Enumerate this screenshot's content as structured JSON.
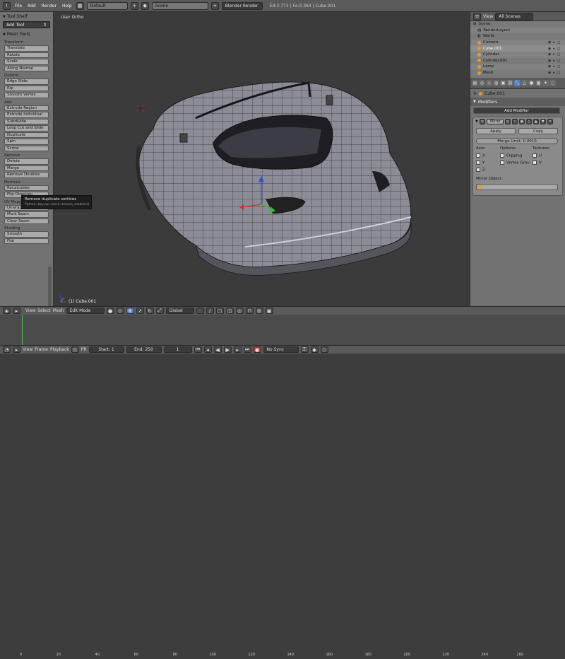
{
  "topbar": {
    "menus": [
      "File",
      "Add",
      "Render",
      "Help"
    ],
    "layout": "Default",
    "scene": "Scene",
    "engine": "Blender Render",
    "stats": "Ed:3-771 | Fa:0-364 | Cube.001"
  },
  "toolshelf": {
    "title": "Tool Shelf",
    "add_tool": "Add Tool",
    "panel": "Mesh Tools",
    "groups": [
      {
        "label": "Transform",
        "buttons": [
          "Translate",
          "Rotate",
          "Scale",
          "Along Normal"
        ]
      },
      {
        "label": "Deform",
        "buttons": [
          "Edge Slide",
          "Rip",
          "Smooth Vertex"
        ]
      },
      {
        "label": "Add",
        "buttons": [
          "Extrude Region",
          "Extrude Individual",
          "Subdivide",
          "Loop Cut and Slide",
          "Duplicate",
          "Spin",
          "Screw"
        ]
      },
      {
        "label": "Remove",
        "buttons": [
          "Delete",
          "Merge",
          "Remove Doubles"
        ]
      },
      {
        "label": "Normals",
        "buttons": [
          "Recalculate",
          "Flip Direction"
        ]
      },
      {
        "label": "UV Mapping",
        "buttons": [
          "Unwrap",
          "Mark Seam",
          "Clear Seam"
        ]
      },
      {
        "label": "Shading",
        "buttons": [
          "Smooth",
          "Flat"
        ]
      }
    ]
  },
  "viewport": {
    "label": "User Ortho",
    "object_label": "(1) Cube.001",
    "tooltip_title": "Remove duplicate vertices",
    "tooltip_python": "Python: bpy.ops.mesh.remove_doubles()"
  },
  "outliner": {
    "view": "View",
    "search": "All Scenes",
    "rows": [
      "Scene",
      "RenderLayers",
      "World",
      "Camera",
      "Cube.001",
      "Cylinder",
      "Cylinder.001",
      "Lamp",
      "Mesh"
    ]
  },
  "properties": {
    "object": "Cube.001",
    "section": "Modifiers",
    "add_modifier": "Add Modifier",
    "mod_name": "Mirror",
    "apply": "Apply",
    "copy": "Copy",
    "merge_limit": "Merge Limit: 0.0010",
    "axis": "Axis:",
    "options": "Options:",
    "textures": "Textures:",
    "ax": [
      "X",
      "Y",
      "Z"
    ],
    "opt": [
      "Clipping",
      "Vertex Grou"
    ],
    "tex": [
      "U",
      "V"
    ],
    "mirror_object": "Mirror Object:"
  },
  "viewheader": {
    "view": "View",
    "select": "Select",
    "mesh": "Mesh",
    "mode": "Edit Mode",
    "orient": "Global"
  },
  "timeline": {
    "ticks": [
      "0",
      "20",
      "40",
      "60",
      "80",
      "100",
      "120",
      "140",
      "160",
      "180",
      "200",
      "220",
      "240",
      "260"
    ],
    "view": "View",
    "frame": "Frame",
    "playback": "Playback",
    "pr": "PR",
    "start": "Start: 1",
    "end": "End: 250",
    "current": "1",
    "sync": "No Sync"
  },
  "colors": {
    "accent": "#5680c2",
    "object": "#e39b32",
    "cursor": "#4bd14b"
  }
}
